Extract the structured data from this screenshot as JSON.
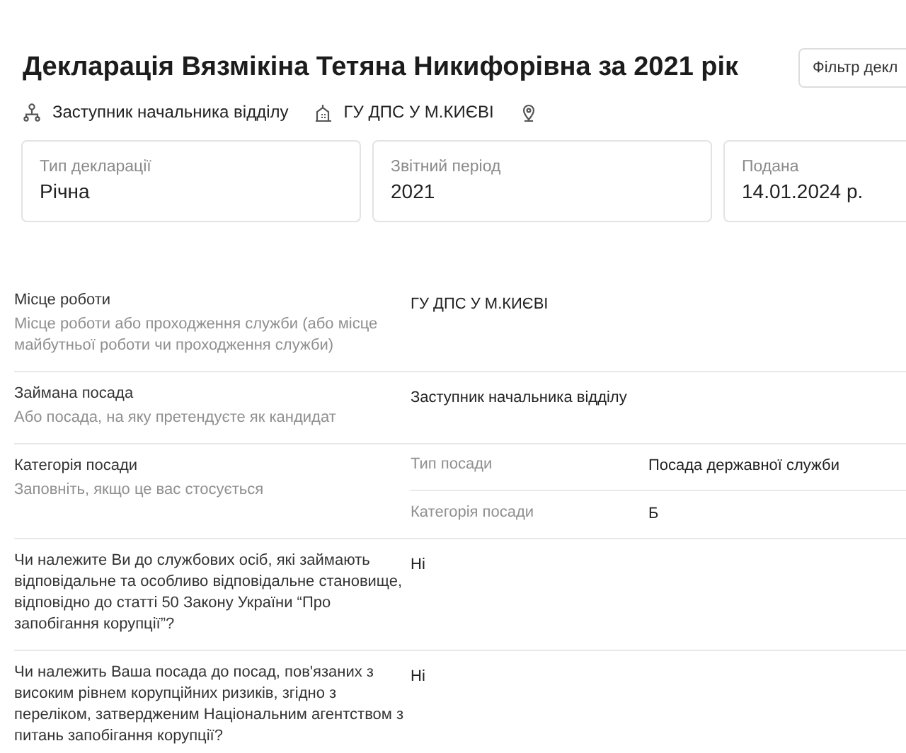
{
  "title": "Декларація Вязмікіна Тетяна Никифорівна за 2021 рік",
  "filter_button": "Фільтр декл",
  "meta": [
    {
      "kind": "position",
      "text": "Заступник начальника відділу"
    },
    {
      "kind": "organization",
      "text": "ГУ ДПС У М.КИЄВІ"
    },
    {
      "kind": "location"
    }
  ],
  "cards": [
    {
      "label": "Тип декларації",
      "value": "Річна"
    },
    {
      "label": "Звітний період",
      "value": "2021"
    },
    {
      "label": "Подана",
      "value": "14.01.2024 р."
    }
  ],
  "rows": [
    {
      "kind": "simple",
      "label": "Місце роботи",
      "hint": "Місце роботи або проходження служби (або місце майбутньої роботи чи проходження служби)",
      "value": "ГУ ДПС У М.КИЄВІ"
    },
    {
      "kind": "simple",
      "label": "Займана посада",
      "hint": "Або посада, на яку претендуєте як кандидат",
      "value": "Заступник начальника відділу"
    },
    {
      "kind": "sub",
      "label": "Категорія посади",
      "hint": "Заповніть, якщо це вас стосується",
      "subrows": [
        {
          "label": "Тип посади",
          "value": "Посада державної служби"
        },
        {
          "label": "Категорія посади",
          "value": "Б"
        }
      ]
    },
    {
      "kind": "simple",
      "label": "Чи належите Ви до службових осіб, які займають відповідальне та особливо відповідальне становище, відповідно до статті 50 Закону України “Про запобігання корупції”?",
      "value": "Ні"
    },
    {
      "kind": "simple",
      "label": "Чи належить Ваша посада до посад, пов'язаних з високим рівнем корупційних ризиків, згідно з переліком, затвердженим Національним агентством з питань запобігання корупції?",
      "value": "Ні"
    }
  ]
}
